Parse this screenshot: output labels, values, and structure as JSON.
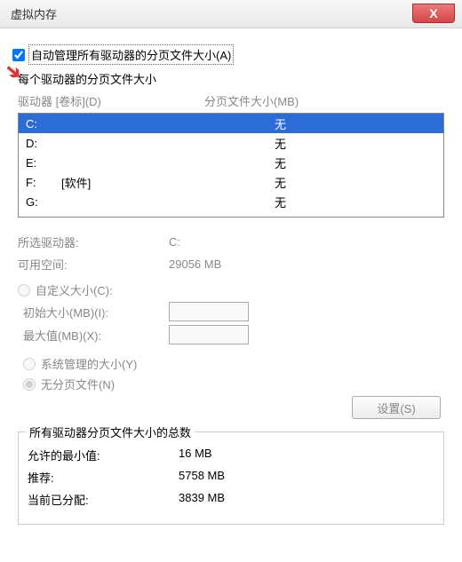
{
  "window": {
    "title": "虚拟内存",
    "close_symbol": "X"
  },
  "autoManage": {
    "checked": true,
    "label": "自动管理所有驱动器的分页文件大小(A)"
  },
  "perDrive": {
    "title": "每个驱动器的分页文件大小",
    "headerDrive": "驱动器 [卷标](D)",
    "headerPaging": "分页文件大小(MB)"
  },
  "drives": [
    {
      "letter": "C:",
      "label": "",
      "paging": "无",
      "selected": true
    },
    {
      "letter": "D:",
      "label": "",
      "paging": "无",
      "selected": false
    },
    {
      "letter": "E:",
      "label": "",
      "paging": "无",
      "selected": false
    },
    {
      "letter": "F:",
      "label": "[软件]",
      "paging": "无",
      "selected": false
    },
    {
      "letter": "G:",
      "label": "",
      "paging": "无",
      "selected": false
    }
  ],
  "selectedInfo": {
    "driveLabel": "所选驱动器:",
    "driveValue": "C:",
    "spaceLabel": "可用空间:",
    "spaceValue": "29056 MB"
  },
  "customSize": {
    "radioLabel": "自定义大小(C):",
    "initialLabel": "初始大小(MB)(I):",
    "initialValue": "",
    "maxLabel": "最大值(MB)(X):",
    "maxValue": ""
  },
  "radios": {
    "systemManaged": "系统管理的大小(Y)",
    "noPaging": "无分页文件(N)",
    "selected": "noPaging"
  },
  "setButton": "设置(S)",
  "summary": {
    "groupTitle": "所有驱动器分页文件大小的总数",
    "minLabel": "允许的最小值:",
    "minValue": "16 MB",
    "recLabel": "推荐:",
    "recValue": "5758 MB",
    "curLabel": "当前已分配:",
    "curValue": "3839 MB"
  }
}
